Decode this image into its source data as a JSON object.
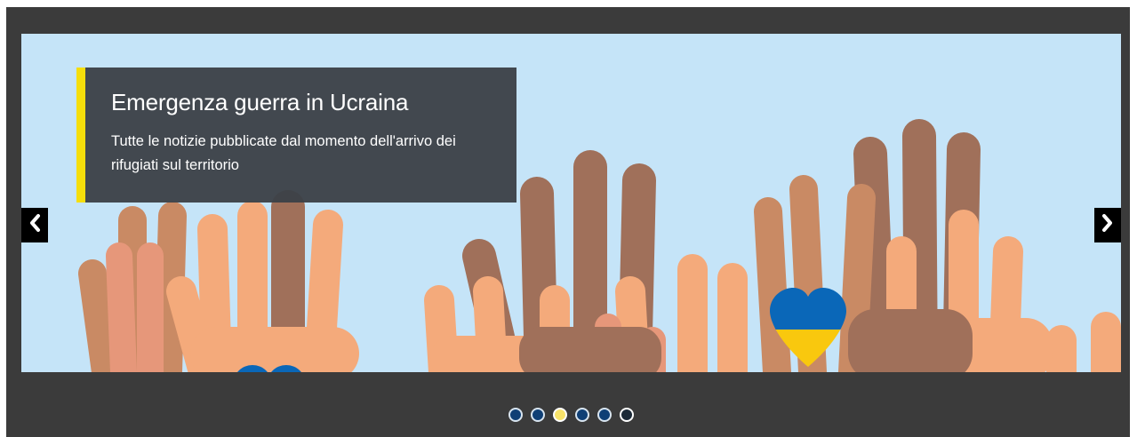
{
  "carousel": {
    "slide": {
      "title": "Emergenza guerra in Ucraina",
      "subtitle": "Tutte le notizie pubblicate dal momento dell'arrivo dei rifugiati sul territorio",
      "image": "raised-hands-ukraine-heart-illustration"
    },
    "controls": {
      "prev_icon": "chevron-left-icon",
      "next_icon": "chevron-right-icon"
    },
    "indicators": {
      "count": 6,
      "active_index": 2
    },
    "colors": {
      "accent": "#f5de0b",
      "caption_bg": "#3c4248",
      "frame_bg": "#3b3b3b",
      "sky": "#c5e4f8",
      "ukraine_blue": "#0a67b8",
      "ukraine_yellow": "#f9c80e"
    }
  }
}
